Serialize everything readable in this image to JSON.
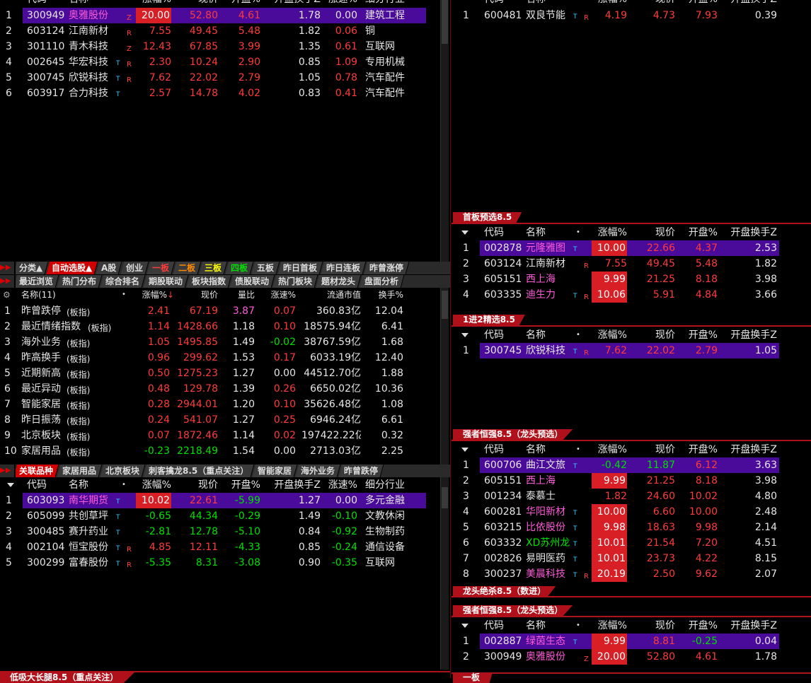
{
  "top_left": {
    "headers": [
      "代码",
      "名称",
      "涨幅%",
      "现价",
      "开盘%",
      "开盘换手Z",
      "涨速%",
      "细分行业"
    ],
    "rows": [
      {
        "i": "1",
        "code": "300949",
        "name": "奥雅股份",
        "flag": "Z",
        "chg": "20.00",
        "price": "52.80",
        "open": "4.61",
        "turn": "1.78",
        "speed": "0.00",
        "ind": "建筑工程",
        "sel": true,
        "pink": true,
        "box": true
      },
      {
        "i": "2",
        "code": "603124",
        "name": "江南新材",
        "flag": "R",
        "chg": "7.55",
        "price": "49.45",
        "open": "5.48",
        "turn": "1.82",
        "speed": "0.06",
        "ind": "铜"
      },
      {
        "i": "3",
        "code": "301110",
        "name": "青木科技",
        "flag": "Z",
        "chg": "12.43",
        "price": "67.85",
        "open": "3.99",
        "turn": "1.35",
        "speed": "0.61",
        "ind": "互联网"
      },
      {
        "i": "4",
        "code": "002645",
        "name": "华宏科技",
        "t": "T",
        "flag": "R",
        "chg": "2.30",
        "price": "10.24",
        "open": "2.90",
        "turn": "0.85",
        "speed": "1.09",
        "ind": "专用机械"
      },
      {
        "i": "5",
        "code": "300745",
        "name": "欣锐科技",
        "t": "T",
        "flag": "R",
        "chg": "7.62",
        "price": "22.02",
        "open": "2.79",
        "turn": "1.05",
        "speed": "0.78",
        "ind": "汽车配件"
      },
      {
        "i": "6",
        "code": "603917",
        "name": "合力科技",
        "t": "T",
        "chg": "2.57",
        "price": "14.78",
        "open": "4.02",
        "turn": "0.83",
        "speed": "0.41",
        "ind": "汽车配件"
      }
    ]
  },
  "top_right": {
    "headers": [
      "代码",
      "名称",
      "涨幅%",
      "现价",
      "开盘%",
      "开盘换手Z"
    ],
    "rows": [
      {
        "i": "1",
        "code": "600481",
        "name": "双良节能",
        "t": "T",
        "flag": "R",
        "chg": "4.19",
        "price": "4.73",
        "open": "7.93",
        "turn": "0.39"
      }
    ]
  },
  "tabs1": [
    {
      "label": "分类▲"
    },
    {
      "label": "自动选股▲",
      "act": true
    },
    {
      "label": "A股"
    },
    {
      "label": "创业"
    },
    {
      "label": "一板",
      "cls": "tred"
    },
    {
      "label": "二板",
      "cls": "tora"
    },
    {
      "label": "三板",
      "cls": "tyel"
    },
    {
      "label": "四板",
      "cls": "tgrn"
    },
    {
      "label": "五板"
    },
    {
      "label": "昨日首板"
    },
    {
      "label": "昨日连板"
    },
    {
      "label": "昨曾涨停"
    }
  ],
  "tabs2": [
    {
      "label": "最近浏览"
    },
    {
      "label": "热门分布"
    },
    {
      "label": "综合排名"
    },
    {
      "label": "期股联动"
    },
    {
      "label": "板块指数"
    },
    {
      "label": "债股联动"
    },
    {
      "label": "热门板块"
    },
    {
      "label": "题材龙头"
    },
    {
      "label": "盘面分析"
    }
  ],
  "sector": {
    "headers": [
      "名称(11)",
      "涨幅%↓",
      "现价",
      "量比",
      "涨速%",
      "流通市值",
      "换手%"
    ],
    "rows": [
      {
        "i": "1",
        "name": "昨曾跌停",
        "tag": "(板指)",
        "chg": "2.41",
        "price": "67.19",
        "vol": "3.87",
        "speed": "0.07",
        "cap": "360.83亿",
        "turn": "12.04",
        "volmag": true
      },
      {
        "i": "2",
        "name": "最近情绪指数",
        "tag": "(板指)",
        "chg": "1.14",
        "price": "1428.66",
        "vol": "1.18",
        "speed": "0.10",
        "cap": "18575.94亿",
        "turn": "6.41"
      },
      {
        "i": "3",
        "name": "海外业务",
        "tag": "(板指)",
        "chg": "1.05",
        "price": "1495.85",
        "vol": "1.49",
        "speed": "-0.02",
        "cap": "38767.59亿",
        "turn": "1.68"
      },
      {
        "i": "4",
        "name": "昨高换手",
        "tag": "(板指)",
        "chg": "0.96",
        "price": "299.62",
        "vol": "1.53",
        "speed": "0.17",
        "cap": "6033.19亿",
        "turn": "12.40"
      },
      {
        "i": "5",
        "name": "近期新高",
        "tag": "(板指)",
        "chg": "0.50",
        "price": "1275.23",
        "vol": "1.27",
        "speed": "0.00",
        "cap": "44512.70亿",
        "turn": "1.88"
      },
      {
        "i": "6",
        "name": "最近异动",
        "tag": "(板指)",
        "chg": "0.48",
        "price": "129.78",
        "vol": "1.39",
        "speed": "0.26",
        "cap": "6650.02亿",
        "turn": "10.36"
      },
      {
        "i": "7",
        "name": "智能家居",
        "tag": "(板指)",
        "chg": "0.28",
        "price": "2944.01",
        "vol": "1.20",
        "speed": "0.10",
        "cap": "35626.48亿",
        "turn": "1.08"
      },
      {
        "i": "8",
        "name": "昨日振荡",
        "tag": "(板指)",
        "chg": "0.24",
        "price": "541.07",
        "vol": "1.27",
        "speed": "0.25",
        "cap": "6946.24亿",
        "turn": "6.61"
      },
      {
        "i": "9",
        "name": "北京板块",
        "tag": "(板指)",
        "chg": "0.07",
        "price": "1872.46",
        "vol": "1.14",
        "speed": "0.02",
        "cap": "197422.22亿",
        "turn": "0.32"
      },
      {
        "i": "10",
        "name": "家居用品",
        "tag": "(板指)",
        "chg": "-0.23",
        "price": "2218.49",
        "vol": "1.54",
        "speed": "0.00",
        "cap": "2713.03亿",
        "turn": "2.25"
      }
    ]
  },
  "tabs3": [
    {
      "label": "关联品种",
      "act": true
    },
    {
      "label": "家居用品"
    },
    {
      "label": "北京板块"
    },
    {
      "label": "刺客擒龙8.5（重点关注）"
    },
    {
      "label": "智能家居"
    },
    {
      "label": "海外业务"
    },
    {
      "label": "昨曾跌停"
    }
  ],
  "related": {
    "headers": [
      "代码",
      "名称",
      "涨幅%",
      "现价",
      "开盘%",
      "开盘换手Z",
      "涨速%",
      "细分行业"
    ],
    "rows": [
      {
        "i": "1",
        "code": "603093",
        "name": "南华期货",
        "t": "T",
        "chg": "10.02",
        "price": "22.61",
        "open": "-5.99",
        "turn": "1.27",
        "speed": "0.00",
        "ind": "多元金融",
        "sel": true,
        "pink": true,
        "box": true
      },
      {
        "i": "2",
        "code": "605099",
        "name": "共创草坪",
        "t": "T",
        "chg": "-0.65",
        "price": "44.34",
        "open": "-0.29",
        "turn": "1.49",
        "speed": "-0.10",
        "ind": "文教休闲"
      },
      {
        "i": "3",
        "code": "300485",
        "name": "赛升药业",
        "t": "T",
        "chg": "-2.81",
        "price": "12.78",
        "open": "-5.10",
        "turn": "0.84",
        "speed": "-0.92",
        "ind": "生物制药"
      },
      {
        "i": "4",
        "code": "002104",
        "name": "恒宝股份",
        "t": "T",
        "flag": "R",
        "chg": "4.85",
        "price": "12.11",
        "open": "-4.33",
        "turn": "0.85",
        "speed": "-0.24",
        "ind": "通信设备"
      },
      {
        "i": "5",
        "code": "300299",
        "name": "富春股份",
        "t": "T",
        "flag": "R",
        "chg": "-5.35",
        "price": "8.31",
        "open": "-3.08",
        "turn": "0.90",
        "speed": "-0.35",
        "ind": "互联网"
      }
    ]
  },
  "bottom_left_label": "低吸大长腿8.5（重点关注）",
  "right_panels": [
    {
      "label": "首板预选8.5",
      "headers": [
        "代码",
        "名称",
        "涨幅%",
        "现价",
        "开盘%",
        "开盘换手Z"
      ],
      "rows": [
        {
          "i": "1",
          "code": "002878",
          "name": "元隆雅图",
          "t": "T",
          "chg": "10.00",
          "price": "22.66",
          "open": "4.37",
          "turn": "2.53",
          "sel": true,
          "pink": true,
          "box": true
        },
        {
          "i": "2",
          "code": "603124",
          "name": "江南新材",
          "flag": "R",
          "chg": "7.55",
          "price": "49.45",
          "open": "5.48",
          "turn": "1.82"
        },
        {
          "i": "3",
          "code": "605151",
          "name": "西上海",
          "chg": "9.99",
          "price": "21.25",
          "open": "8.18",
          "turn": "3.98",
          "pink": true,
          "box": true
        },
        {
          "i": "4",
          "code": "603335",
          "name": "迪生力",
          "t": "T",
          "flag": "R",
          "chg": "10.06",
          "price": "5.91",
          "open": "4.84",
          "turn": "3.66",
          "pink": true,
          "box": true
        }
      ]
    },
    {
      "label": "1进2精选8.5",
      "headers": [
        "代码",
        "名称",
        "涨幅%",
        "现价",
        "开盘%",
        "开盘换手Z"
      ],
      "rows": [
        {
          "i": "1",
          "code": "300745",
          "name": "欣锐科技",
          "t": "T",
          "flag": "R",
          "chg": "7.62",
          "price": "22.02",
          "open": "2.79",
          "turn": "1.05",
          "sel": true
        }
      ]
    },
    {
      "label": "强者恒强8.5（龙头预选）",
      "headers": [
        "代码",
        "名称",
        "涨幅%",
        "现价",
        "开盘%",
        "开盘换手Z"
      ],
      "rows": [
        {
          "i": "1",
          "code": "600706",
          "name": "曲江文旅",
          "t": "T",
          "chg": "-0.42",
          "price": "11.87",
          "open": "6.12",
          "turn": "3.63",
          "sel": true
        },
        {
          "i": "2",
          "code": "605151",
          "name": "西上海",
          "chg": "9.99",
          "price": "21.25",
          "open": "8.18",
          "turn": "3.98",
          "pink": true,
          "box": true
        },
        {
          "i": "3",
          "code": "001234",
          "name": "泰慕士",
          "chg": "1.82",
          "price": "24.60",
          "open": "10.02",
          "turn": "4.80"
        },
        {
          "i": "4",
          "code": "600281",
          "name": "华阳新材",
          "t": "T",
          "chg": "10.00",
          "price": "6.60",
          "open": "10.00",
          "turn": "2.48",
          "pink": true,
          "box": true
        },
        {
          "i": "5",
          "code": "603215",
          "name": "比依股份",
          "t": "T",
          "chg": "9.98",
          "price": "18.63",
          "open": "9.98",
          "turn": "2.14",
          "pink": true,
          "box": true
        },
        {
          "i": "6",
          "code": "603332",
          "name": "XD苏州龙",
          "t": "T",
          "chg": "10.01",
          "price": "21.54",
          "open": "7.20",
          "turn": "4.51",
          "pink": true,
          "box": true,
          "green": true
        },
        {
          "i": "7",
          "code": "002826",
          "name": "易明医药",
          "t": "T",
          "chg": "10.01",
          "price": "23.73",
          "open": "4.22",
          "turn": "8.15",
          "box": true
        },
        {
          "i": "8",
          "code": "300237",
          "name": "美晨科技",
          "t": "T",
          "flag": "R",
          "chg": "20.19",
          "price": "2.50",
          "open": "9.62",
          "turn": "2.07",
          "pink": true,
          "box": true
        }
      ]
    },
    {
      "label": "强者恒强8.5（龙头预选）",
      "headers": [
        "代码",
        "名称",
        "涨幅%",
        "现价",
        "开盘%",
        "开盘换手Z"
      ],
      "rows": [
        {
          "i": "1",
          "code": "002887",
          "name": "绿茵生态",
          "t": "T",
          "chg": "9.99",
          "price": "8.81",
          "open": "-0.25",
          "turn": "0.04",
          "sel": true,
          "pink": true,
          "box": true
        },
        {
          "i": "2",
          "code": "300949",
          "name": "奥雅股份",
          "flag": "Z",
          "chg": "20.00",
          "price": "52.80",
          "open": "4.61",
          "turn": "1.78",
          "pink": true,
          "box": true
        }
      ]
    }
  ],
  "dragon_label": "龙头绝杀8.5（数进）",
  "bottom_right_label": "一板"
}
